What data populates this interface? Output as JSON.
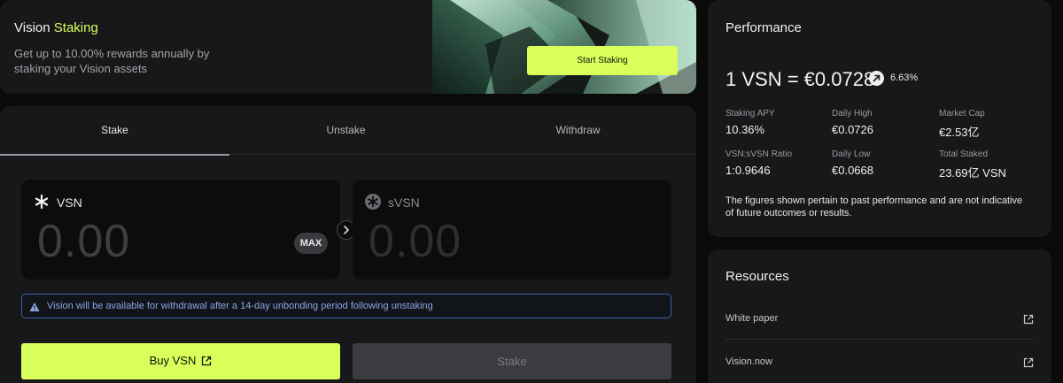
{
  "hero": {
    "title_prefix": "Vision",
    "title_accent": "Staking",
    "subtitle": "Get up to 10.00% rewards annually by staking your Vision assets",
    "cta_label": "Start Staking"
  },
  "tabs": [
    {
      "label": "Stake",
      "active": true
    },
    {
      "label": "Unstake",
      "active": false
    },
    {
      "label": "Withdraw",
      "active": false
    }
  ],
  "from_token": {
    "symbol": "VSN",
    "amount": "0.00",
    "max_label": "MAX",
    "icon": "asterisk-icon"
  },
  "to_token": {
    "symbol": "sVSN",
    "amount": "0.00",
    "icon": "asterisk-circle-icon"
  },
  "notice": {
    "text": "Vision will be available for withdrawal after a 14-day unbonding period following unstaking",
    "icon": "warning-icon"
  },
  "actions": {
    "buy_label": "Buy VSN",
    "stake_label": "Stake"
  },
  "performance": {
    "title": "Performance",
    "price": "1 VSN = €0.0728",
    "change": "6.63%",
    "stats": [
      {
        "label": "Staking APY",
        "value": "10.36%"
      },
      {
        "label": "Daily High",
        "value": "€0.0726"
      },
      {
        "label": "Market Cap",
        "value": "€2.53亿"
      },
      {
        "label": "VSN:sVSN Ratio",
        "value": "1:0.9646"
      },
      {
        "label": "Daily Low",
        "value": "€0.0668"
      },
      {
        "label": "Total Staked",
        "value": "23.69亿 VSN"
      }
    ],
    "disclaimer": "The figures shown pertain to past performance and are not indicative of future outcomes or results."
  },
  "resources": {
    "title": "Resources",
    "items": [
      {
        "label": "White paper",
        "icon": "external-link-icon"
      },
      {
        "label": "Vision.now",
        "icon": "external-link-icon"
      }
    ]
  },
  "colors": {
    "accent": "#d9ff5a",
    "notice_border": "#3a5ea8",
    "notice_text": "#8aa7e6"
  }
}
